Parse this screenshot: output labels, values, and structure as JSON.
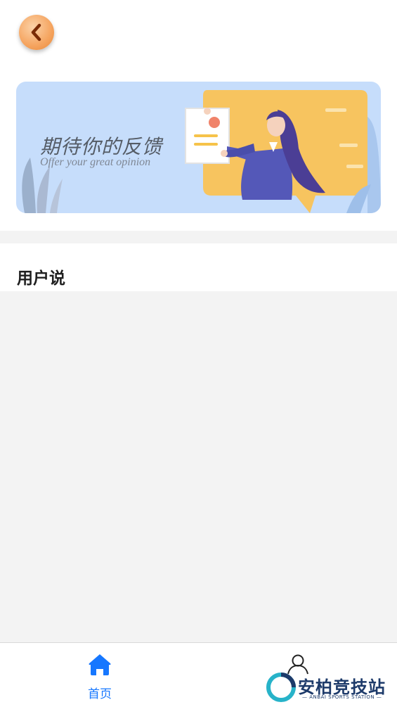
{
  "header": {
    "back_icon": "chevron-left-icon"
  },
  "banner": {
    "title": "期待你的反馈",
    "subtitle": "Offer your great opinion"
  },
  "section": {
    "title": "用户说"
  },
  "tabbar": {
    "items": [
      {
        "label": "首页",
        "icon": "home-icon",
        "active": true
      },
      {
        "label": "",
        "icon": "user-icon",
        "active": false
      }
    ]
  },
  "watermark": {
    "text": "安柏竞技站",
    "subtext": "— ANBAI SPORTS STATION —"
  },
  "colors": {
    "accent": "#1677ff",
    "back_button": "#f5a45f",
    "banner_bg": "#c6ddfb",
    "page_bg": "#f3f3f3"
  }
}
